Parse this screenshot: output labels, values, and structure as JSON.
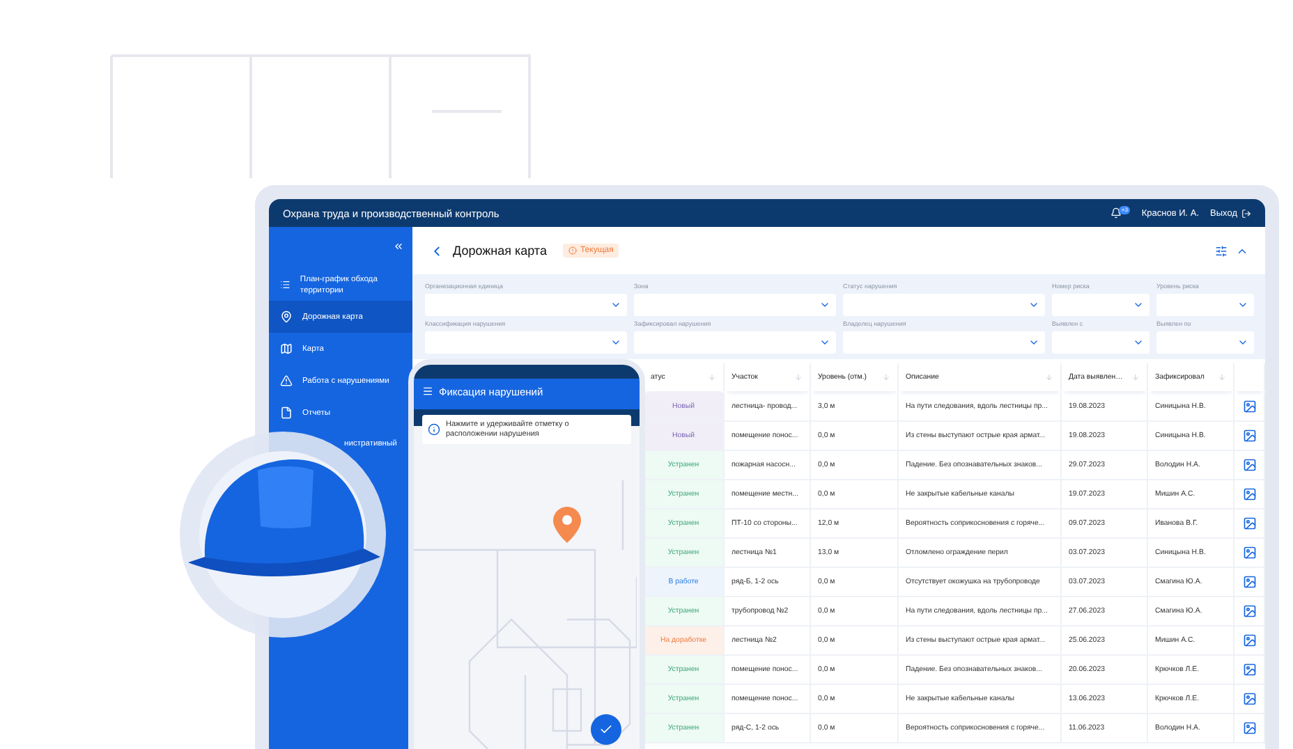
{
  "app": {
    "title": "Охрана труда и производственный контроль",
    "notifications": "+3",
    "user": "Краснов И. А.",
    "logout": "Выход"
  },
  "sidebar": {
    "items": [
      {
        "label": "План-график обхода территории",
        "selected": false
      },
      {
        "label": "Дорожная карта",
        "selected": true
      },
      {
        "label": "Карта",
        "selected": false
      },
      {
        "label": "Работа с нарушениями",
        "selected": false
      },
      {
        "label": "Отчеты",
        "selected": false
      },
      {
        "label": "нистративный",
        "selected": false
      }
    ]
  },
  "page": {
    "title": "Дорожная карта",
    "status": "Текущая"
  },
  "filters": [
    {
      "label": "Организационная единица"
    },
    {
      "label": "Зона"
    },
    {
      "label": "Статус нарушения"
    },
    {
      "label": "Номер риска"
    },
    {
      "label": "Уровень риска"
    },
    {
      "label": "Классификация нарушения"
    },
    {
      "label": "Зафиксировал нарушения"
    },
    {
      "label": "Владелец нарушения"
    },
    {
      "label": "Выявлен с"
    },
    {
      "label": "Выявлен по"
    }
  ],
  "table": {
    "columns": [
      "атус",
      "Участок",
      "Уровень (отм.)",
      "Описание",
      "Дата выявлен…",
      "Зафиксировал"
    ],
    "rows": [
      {
        "status": {
          "text": "Новый",
          "kind": "new"
        },
        "section": "лестница- провод...",
        "level_mark": "3,0 м",
        "description": "На пути следования, вдоль лестницы пр...",
        "date": "19.08.2023",
        "recorded_by": "Синицына Н.В."
      },
      {
        "status": {
          "text": "Новый",
          "kind": "new"
        },
        "section": "помещение понос...",
        "level_mark": "0,0 м",
        "description": "Из стены выступают острые края армат...",
        "date": "19.08.2023",
        "recorded_by": "Синицына Н.В."
      },
      {
        "status": {
          "text": "Устранен",
          "kind": "fixed"
        },
        "section": "пожарная насосн...",
        "level_mark": "0,0 м",
        "description": "Падение. Без опознавательных знаков...",
        "date": "29.07.2023",
        "recorded_by": "Володин Н.А."
      },
      {
        "status": {
          "text": "Устранен",
          "kind": "fixed"
        },
        "section": "помещение местн...",
        "level_mark": "0,0 м",
        "description": "Не закрытые кабельные каналы",
        "date": "19.07.2023",
        "recorded_by": "Мишин А.С."
      },
      {
        "status": {
          "text": "Устранен",
          "kind": "fixed"
        },
        "section": "ПТ-10 со стороны...",
        "level_mark": "12,0 м",
        "description": "Вероятность соприкосновения с горяче...",
        "date": "09.07.2023",
        "recorded_by": "Иванова В.Г."
      },
      {
        "status": {
          "text": "Устранен",
          "kind": "fixed"
        },
        "section": "лестница №1",
        "level_mark": "13,0 м",
        "description": "Отломлено ограждение перил",
        "date": "03.07.2023",
        "recorded_by": "Синицына Н.В."
      },
      {
        "status": {
          "text": "В работе",
          "kind": "in_work"
        },
        "section": "ряд-Б, 1-2 ось",
        "level_mark": "0,0 м",
        "description": "Отсутствует окожушка на трубопроводе",
        "date": "03.07.2023",
        "recorded_by": "Смагина Ю.А."
      },
      {
        "status": {
          "text": "Устранен",
          "kind": "fixed"
        },
        "section": "трубопровод №2",
        "level_mark": "0,0 м",
        "description": "На пути следования, вдоль лестницы пр...",
        "date": "27.06.2023",
        "recorded_by": "Смагина Ю.А."
      },
      {
        "status": {
          "text": "На доработке",
          "kind": "rework"
        },
        "section": "лестница №2",
        "level_mark": "0,0 м",
        "description": "Из стены выступают острые края армат...",
        "date": "25.06.2023",
        "recorded_by": "Мишин А.С."
      },
      {
        "status": {
          "text": "Устранен",
          "kind": "fixed"
        },
        "section": "помещение понос...",
        "level_mark": "0,0 м",
        "description": "Падение. Без опознавательных знаков...",
        "date": "20.06.2023",
        "recorded_by": "Крючков Л.Е."
      },
      {
        "status": {
          "text": "Устранен",
          "kind": "fixed"
        },
        "section": "помещение понос...",
        "level_mark": "0,0 м",
        "description": "Не закрытые кабельные каналы",
        "date": "13.06.2023",
        "recorded_by": "Крючков Л.Е."
      },
      {
        "status": {
          "text": "Устранен",
          "kind": "fixed"
        },
        "section": "ряд-С, 1-2 ось",
        "level_mark": "0,0 м",
        "description": "Вероятность соприкосновения с горяче...",
        "date": "11.06.2023",
        "recorded_by": "Володин Н.А."
      }
    ]
  },
  "mobile": {
    "title": "Фиксация нарушений",
    "hint": "Нажмите и удерживайте отметку о расположении нарушения"
  }
}
